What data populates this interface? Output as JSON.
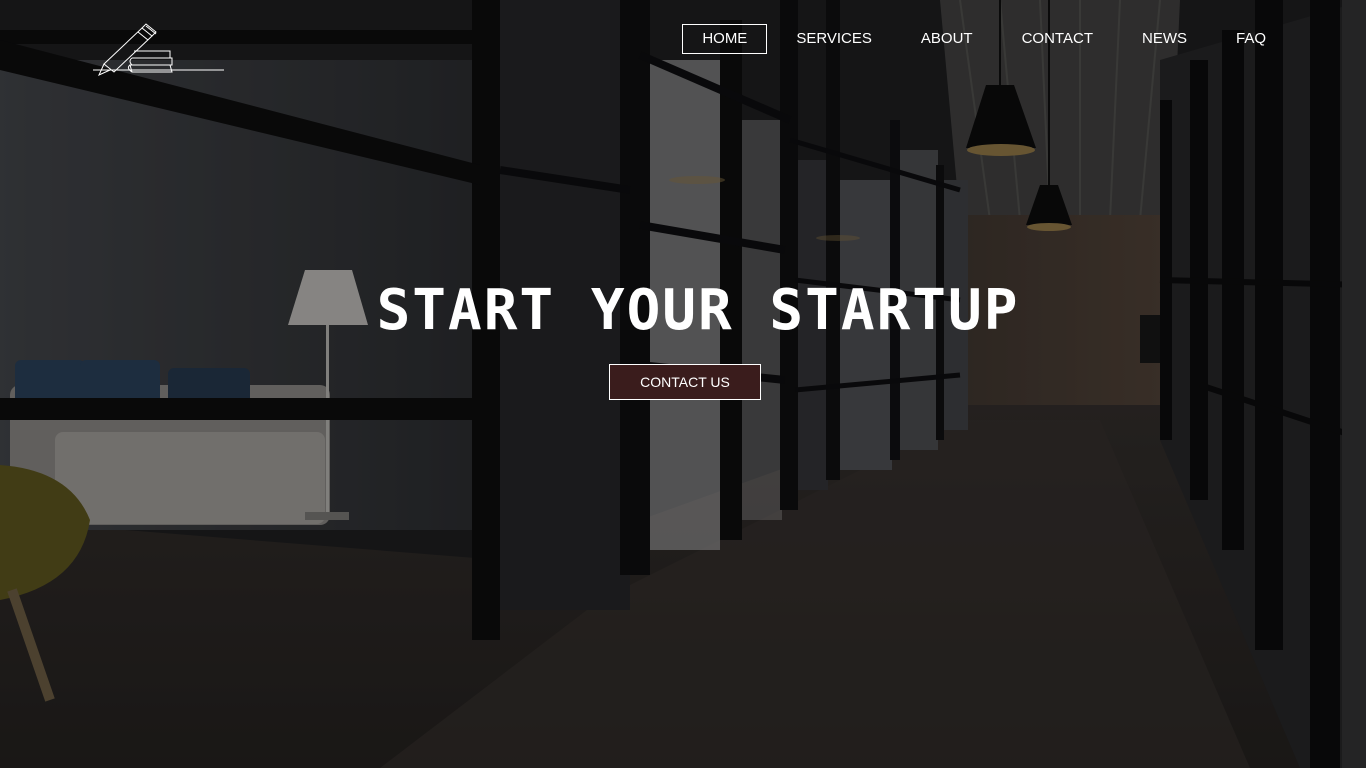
{
  "nav": {
    "items": [
      {
        "label": "HOME",
        "active": true
      },
      {
        "label": "SERVICES",
        "active": false
      },
      {
        "label": "ABOUT",
        "active": false
      },
      {
        "label": "CONTACT",
        "active": false
      },
      {
        "label": "NEWS",
        "active": false
      },
      {
        "label": "FAQ",
        "active": false
      }
    ]
  },
  "hero": {
    "title": "START YOUR STARTUP",
    "cta_label": "CONTACT US",
    "background": "office-corridor-photo",
    "cta_color": "#3a1c1c"
  },
  "logo": {
    "icon": "stacked-books-with-pencil-icon"
  }
}
